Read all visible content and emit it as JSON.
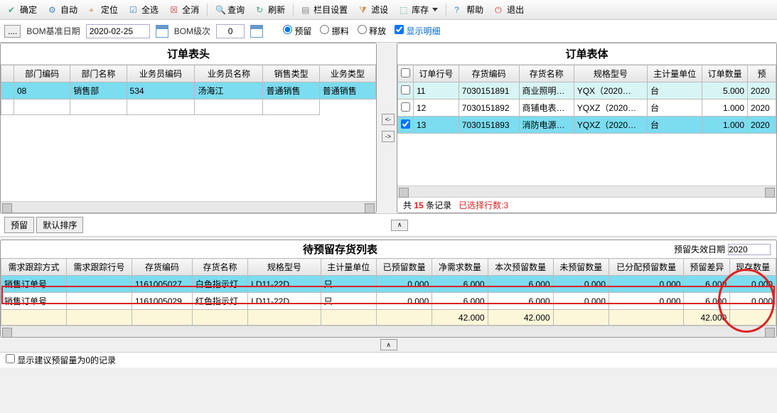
{
  "toolbar": {
    "confirm": "确定",
    "auto": "自动",
    "locate": "定位",
    "selall": "全选",
    "selnone": "全消",
    "query": "查询",
    "refresh": "刷新",
    "colset": "栏目设置",
    "filter": "滤设",
    "stock": "库存",
    "help": "帮助",
    "exit": "退出"
  },
  "params": {
    "bom_date_label": "BOM基准日期",
    "bom_date": "2020-02-25",
    "bom_level_label": "BOM级次",
    "bom_level": "0",
    "r_reserve": "预留",
    "r_material": "挪料",
    "r_release": "释放",
    "chk_detail": "显示明细"
  },
  "left": {
    "title": "订单表头",
    "cols": [
      "部门编码",
      "部门名称",
      "业务员编码",
      "业务员名称",
      "销售类型",
      "业务类型"
    ],
    "row": [
      "08",
      "销售部",
      "534",
      "汤海江",
      "普通销售",
      "普通销售"
    ]
  },
  "right": {
    "title": "订单表体",
    "cols": [
      "订单行号",
      "存货编码",
      "存货名称",
      "规格型号",
      "主计量单位",
      "订单数量",
      "预"
    ],
    "rows": [
      {
        "c": [
          "11",
          "7030151891",
          "商业照明…",
          "YQX（2020…",
          "台",
          "5.000",
          "2020"
        ],
        "sel": false,
        "cls": "row-alt"
      },
      {
        "c": [
          "12",
          "7030151892",
          "商铺电表…",
          "YQXZ（2020…",
          "台",
          "1.000",
          "2020"
        ],
        "sel": false,
        "cls": ""
      },
      {
        "c": [
          "13",
          "7030151893",
          "消防电源…",
          "YQXZ（2020…",
          "台",
          "1.000",
          "2020"
        ],
        "sel": true,
        "cls": "row-sel"
      }
    ],
    "total": "15",
    "total_lbl_pre": "共",
    "total_lbl_post": "条记录",
    "sel_lbl": "已选择行数:",
    "sel_count": "3"
  },
  "mid": {
    "reserve": "预留",
    "defsort": "默认排序"
  },
  "bottom": {
    "title": "待预留存货列表",
    "expire_label": "预留失效日期",
    "expire_val": "2020",
    "cols": [
      "需求跟踪方式",
      "需求跟踪行号",
      "存货编码",
      "存货名称",
      "规格型号",
      "主计量单位",
      "已预留数量",
      "净需求数量",
      "本次预留数量",
      "未预留数量",
      "已分配预留数量",
      "预留差异",
      "现存数量"
    ],
    "rows": [
      {
        "c": [
          "销售订单号",
          "",
          "1161005027",
          "白色指示灯",
          "LD11-22D ．．．",
          "只",
          "0.000",
          "6.000",
          "6.000",
          "0.000",
          "0.000",
          "6.000",
          "0.000"
        ],
        "cls": "row-highlight"
      },
      {
        "c": [
          "销售订单号",
          "",
          "1161005029",
          "红色指示灯",
          "LD11-22D ．．．",
          "只",
          "0.000",
          "6.000",
          "6.000",
          "0.000",
          "0.000",
          "6.000",
          "0.000"
        ],
        "cls": ""
      },
      {
        "c": [
          "",
          "",
          "",
          "",
          "",
          "",
          "",
          "42.000",
          "42.000",
          "",
          "",
          "42.000",
          ""
        ],
        "cls": "row-yellow"
      }
    ],
    "hint": "显示建议预留量为0的记录"
  }
}
